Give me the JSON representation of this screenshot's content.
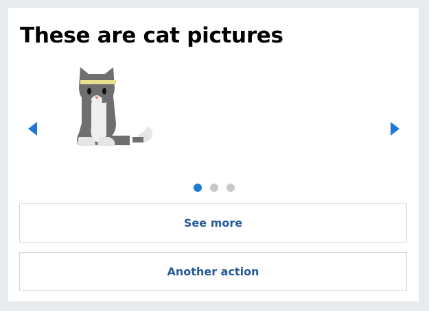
{
  "card": {
    "title": "These are cat pictures"
  },
  "carousel": {
    "previous_icon": "triangle-left-icon",
    "next_icon": "triangle-right-icon",
    "image": "cat-with-headband",
    "page_count": 3,
    "active_page": 1,
    "accent_color": "#1f78d1"
  },
  "actions": [
    {
      "label": "See more"
    },
    {
      "label": "Another action"
    }
  ]
}
